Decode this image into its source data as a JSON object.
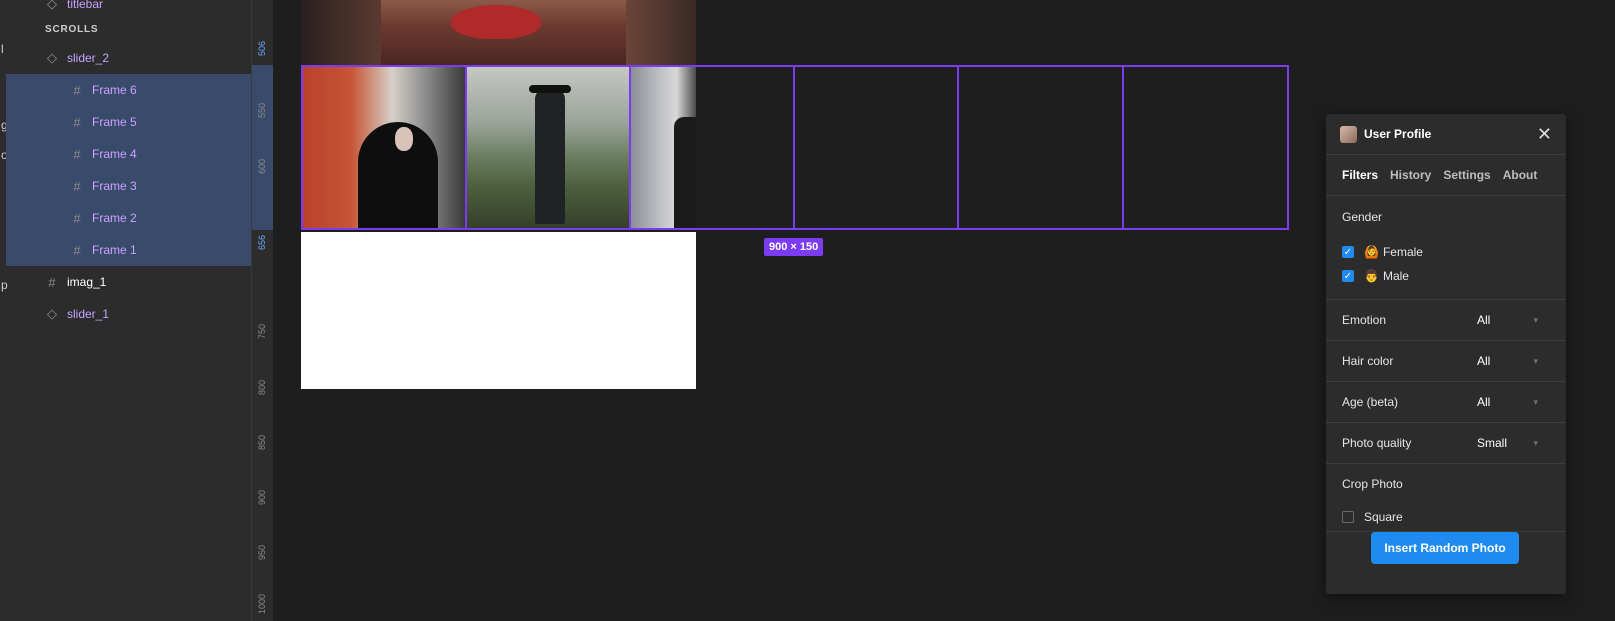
{
  "layers": {
    "edge_glyphs": [
      "l",
      "g",
      "o",
      "p"
    ],
    "section_title": "SCROLLS",
    "items": [
      {
        "label": "titlebar",
        "icon": "component-icon",
        "selected": false
      },
      {
        "label": "slider_2",
        "icon": "component-icon",
        "selected": false
      },
      {
        "label": "Frame 6",
        "icon": "frame-icon",
        "selected": true
      },
      {
        "label": "Frame 5",
        "icon": "frame-icon",
        "selected": true
      },
      {
        "label": "Frame 4",
        "icon": "frame-icon",
        "selected": true
      },
      {
        "label": "Frame 3",
        "icon": "frame-icon",
        "selected": true
      },
      {
        "label": "Frame 2",
        "icon": "frame-icon",
        "selected": true
      },
      {
        "label": "Frame 1",
        "icon": "frame-icon",
        "selected": true
      },
      {
        "label": "imag_1",
        "icon": "frame-icon",
        "selected": false
      },
      {
        "label": "slider_1",
        "icon": "component-icon",
        "selected": false
      }
    ]
  },
  "ruler": {
    "ticks": [
      "506",
      "550",
      "600",
      "656",
      "750",
      "800",
      "850",
      "900",
      "950",
      "1000"
    ]
  },
  "canvas": {
    "size_badge": "900 × 150"
  },
  "plugin": {
    "title": "User Profile",
    "tabs": [
      "Filters",
      "History",
      "Settings",
      "About"
    ],
    "active_tab": "Filters",
    "gender": {
      "label": "Gender",
      "options": [
        {
          "label": "Female",
          "emoji": "🙆",
          "checked": true
        },
        {
          "label": "Male",
          "emoji": "👨",
          "checked": true
        }
      ]
    },
    "selects": [
      {
        "label": "Emotion",
        "value": "All"
      },
      {
        "label": "Hair color",
        "value": "All"
      },
      {
        "label": "Age (beta)",
        "value": "All"
      },
      {
        "label": "Photo quality",
        "value": "Small"
      }
    ],
    "crop": {
      "label": "Crop Photo",
      "option": "Square",
      "checked": false
    },
    "insert_button": "Insert Random Photo",
    "accent": "#1f8bf0"
  },
  "selection_color": "#7b3bf0"
}
